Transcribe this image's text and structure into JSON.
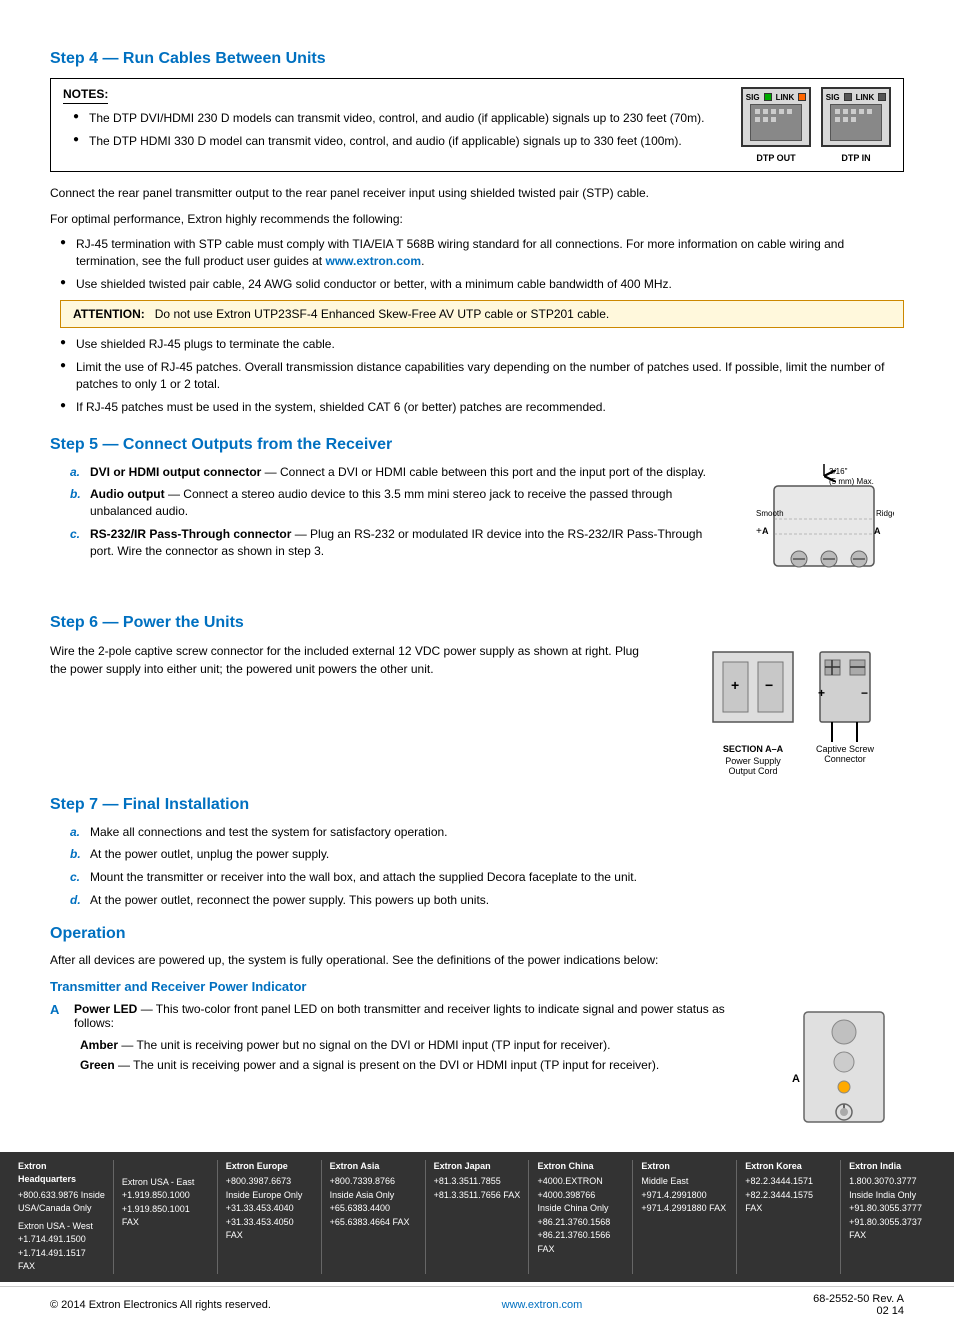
{
  "page": {
    "step4": {
      "heading": "Step 4 — Run Cables Between Units",
      "notes_label": "NOTES:",
      "notes": [
        "The DTP DVI/HDMI 230 D models can transmit video, control, and audio (if applicable) signals up to 230 feet (70m).",
        "The DTP HDMI 330 D model can transmit video, control, and audio (if applicable) signals up to 330 feet (100m)."
      ],
      "para1": "Connect the rear panel transmitter output to the rear panel receiver input using shielded twisted pair (STP) cable.",
      "para2": "For optimal performance, Extron highly recommends the following:",
      "bullets": [
        "RJ-45 termination with STP cable must comply with TIA/EIA T 568B wiring standard for all connections. For more information on cable wiring and termination, see the full product user guides at www.extron.com.",
        "Use shielded twisted pair cable, 24 AWG solid conductor or better, with a minimum cable bandwidth of 400 MHz."
      ],
      "attention_label": "ATTENTION:",
      "attention_text": "Do not use Extron UTP23SF-4 Enhanced Skew-Free AV UTP cable or STP201 cable.",
      "bullets2": [
        "Use shielded RJ-45 plugs to terminate the cable.",
        "Limit the use of RJ-45 patches. Overall transmission distance capabilities vary depending on the number of patches used. If possible, limit the number of patches to only 1 or 2 total.",
        "If RJ-45 patches must be used in the system, shielded CAT 6 (or better) patches are recommended."
      ],
      "dtp_out_label": "DTP OUT",
      "dtp_in_label": "DTP IN"
    },
    "step5": {
      "heading": "Step 5 — Connect Outputs from the Receiver",
      "items": [
        {
          "letter": "a.",
          "bold": "DVI or HDMI output connector",
          "text": " — Connect a DVI or HDMI cable between this port and the input port of the display."
        },
        {
          "letter": "b.",
          "bold": "Audio output",
          "text": " — Connect a stereo audio device to this 3.5 mm mini stereo jack to receive the passed through unbalanced audio."
        },
        {
          "letter": "c.",
          "bold": "RS-232/IR Pass-Through connector",
          "text": " — Plug an RS-232 or modulated IR device into the RS-232/IR Pass-Through port. Wire the connector as shown in step 3."
        }
      ],
      "diagram_note": "3/16\" (5 mm) Max.",
      "smooth_label": "Smooth",
      "ridges_label": "Ridges"
    },
    "step6": {
      "heading": "Step 6 — Power the Units",
      "para": "Wire the 2-pole captive screw connector for the included external 12 VDC power supply as shown at right. Plug the power supply into either unit; the powered unit powers the other unit.",
      "section_label": "SECTION A–A",
      "power_supply_label": "Power Supply\nOutput Cord",
      "captive_label": "Captive Screw\nConnector"
    },
    "step7": {
      "heading": "Step 7 — Final Installation",
      "items": [
        {
          "letter": "a.",
          "text": "Make all connections and test the system for satisfactory operation."
        },
        {
          "letter": "b.",
          "text": "At the power outlet, unplug the power supply."
        },
        {
          "letter": "c.",
          "text": "Mount the transmitter or receiver into the wall box, and attach the supplied Decora faceplate to the unit."
        },
        {
          "letter": "d.",
          "text": "At the power outlet, reconnect the power supply. This powers up both units."
        }
      ]
    },
    "operation": {
      "heading": "Operation",
      "para": "After all devices are powered up, the system is fully operational. See the definitions of the power indications below:",
      "sub_heading": "Transmitter and Receiver Power Indicator",
      "indicator_letter": "A",
      "indicator_bold": "Power LED",
      "indicator_text": " — This two-color front panel LED on both transmitter and receiver lights to indicate signal and power status as follows:",
      "amber_label": "Amber",
      "amber_text": " — The unit is receiving power but no signal on the DVI or HDMI input (TP input for receiver).",
      "green_label": "Green",
      "green_text": " — The unit is receiving power and a signal is present on the DVI or HDMI input (TP input for receiver)."
    },
    "footer": {
      "cols": [
        {
          "title": "Extron Headquarters",
          "lines": [
            "+800.633.9876 Inside USA/Canada Only",
            "",
            "Extron USA - West",
            "+1.714.491.1500",
            "+1.714.491.1517 FAX"
          ]
        },
        {
          "title": "",
          "lines": [
            "",
            "",
            "Extron USA - East",
            "+1.919.850.1000",
            "+1.919.850.1001 FAX"
          ]
        },
        {
          "title": "Extron Europe",
          "lines": [
            "+800.3987.6673",
            "Inside Europe Only",
            "",
            "+31.33.453.4040",
            "+31.33.453.4050 FAX"
          ]
        },
        {
          "title": "Extron Asia",
          "lines": [
            "+800.7339.8766",
            "Inside Asia Only",
            "",
            "+65.6383.4400",
            "+65.6383.4664 FAX"
          ]
        },
        {
          "title": "Extron Japan",
          "lines": [
            "",
            "",
            "",
            "+81.3.3511.7855",
            "+81.3.3511.7656 FAX"
          ]
        },
        {
          "title": "Extron China",
          "lines": [
            "+4000.EXTRON",
            "+4000.398766",
            "Inside China Only",
            "+86.21.3760.1568",
            "+86.21.3760.1566",
            "FAX"
          ]
        },
        {
          "title": "Extron",
          "lines": [
            "Middle East",
            "",
            "+971.4.2991800",
            "+971.4.2991880 FAX"
          ]
        },
        {
          "title": "Extron Korea",
          "lines": [
            "",
            "",
            "+82.2.3444.1571",
            "+82.2.3444.1575 FAX"
          ]
        },
        {
          "title": "Extron India",
          "lines": [
            "1.800.3070.3777",
            "Inside India Only",
            "",
            "+91.80.3055.3777",
            "+91.80.3055.3737",
            "FAX"
          ]
        }
      ],
      "copyright": "© 2014 Extron Electronics   All rights reserved.",
      "website": "www.extron.com",
      "doc_number": "68-2552-50 Rev. A",
      "doc_date": "02 14"
    }
  }
}
